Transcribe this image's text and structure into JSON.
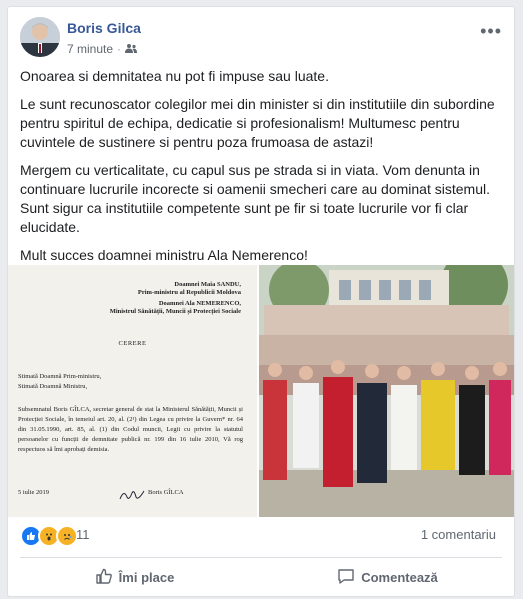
{
  "post": {
    "author": "Boris Gilca",
    "time": "7 minute",
    "audience_icon": "friends-icon",
    "more_icon": "more-options-icon",
    "paragraphs": [
      "Onoarea si demnitatea nu pot fi impuse sau luate.",
      "Le sunt recunoscator colegilor mei din minister si din institutiile din subordine pentru spiritul de echipa, dedicatie si profesionalism! Multumesc pentru cuvintele de sustinere si pentru poza frumoasa de astazi!",
      "Mergem cu verticalitate, cu capul sus pe strada si in viata. Vom denunta in continuare lucrurile incorecte si oamenii smecheri care au dominat sistemul. Sunt sigur ca institutiile competente sunt pe fir si toate lucrurile vor fi clar elucidate.",
      "Mult succes doamnei ministru Ala Nemerenco!"
    ]
  },
  "document": {
    "to1_line1": "Doamnei Maia SANDU,",
    "to1_line2": "Prim-ministru al Republicii Moldova",
    "to2_line1": "Doamnei Ala NEMERENCO,",
    "to2_line2": "Ministrul Sănătății, Muncii și Protecției Sociale",
    "title": "CERERE",
    "salutation1": "Stimată Doamnă Prim-ministru,",
    "salutation2": "Stimată Doamnă Ministru,",
    "body": "Subsemnatul Boris GÎLCA, secretar general de stat la Ministerul Sănătății, Muncii și Protecției Sociale, în temeiul art. 20, al. (2¹) din Legea cu privire la Guvern* nr. 64 din 31.05.1990, art. 85, al. (1) din Codul muncii, Legii cu privire la statutul persoanelor cu funcții de demnitate publică nr. 199 din 16 iulie 2010, Vă rog respectuos să îmi aprobați demisia.",
    "date": "5 iulie 2019",
    "signature_name": "Boris GÎLCA"
  },
  "reactions": {
    "icons": [
      "like-icon",
      "wow-icon",
      "sad-icon"
    ],
    "count": "11",
    "comments": "1 comentariu"
  },
  "actions": {
    "like_label": "Îmi place",
    "comment_label": "Comentează"
  },
  "colors": {
    "author": "#385898",
    "like": "#1877f2",
    "wow": "#f7b125",
    "background": "#e9ebee"
  }
}
